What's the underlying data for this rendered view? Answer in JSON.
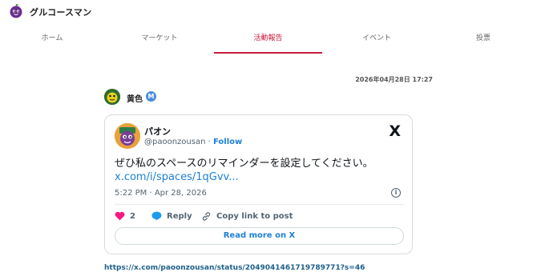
{
  "app": {
    "name": "グルコースマン"
  },
  "nav": {
    "tabs": [
      {
        "label": "ホーム"
      },
      {
        "label": "マーケット"
      },
      {
        "label": "活動報告",
        "active": true
      },
      {
        "label": "イベント"
      },
      {
        "label": "投票"
      }
    ]
  },
  "post": {
    "timestamp": "2026年04月28日 17:27",
    "author": {
      "name": "黄色",
      "badge": "M"
    },
    "url": "https://x.com/paoonzousan/status/2049041461719789771?s=46"
  },
  "tweet": {
    "name": "パオン",
    "handle": "@paoonzousan",
    "separator": "·",
    "follow": "Follow",
    "text": "ぜひ私のスペースのリマインダーを設定してください。",
    "link": "x.com/i/spaces/1qGvv...",
    "meta": "5:22 PM · Apr 28, 2026",
    "info": "i",
    "likes": "2",
    "reply": "Reply",
    "copy_link": "Copy link to post",
    "read_more": "Read more on X",
    "x_logo": "X"
  },
  "colors": {
    "accent": "#c81c3c",
    "link": "#1d7fd6",
    "like": "#f91880"
  }
}
